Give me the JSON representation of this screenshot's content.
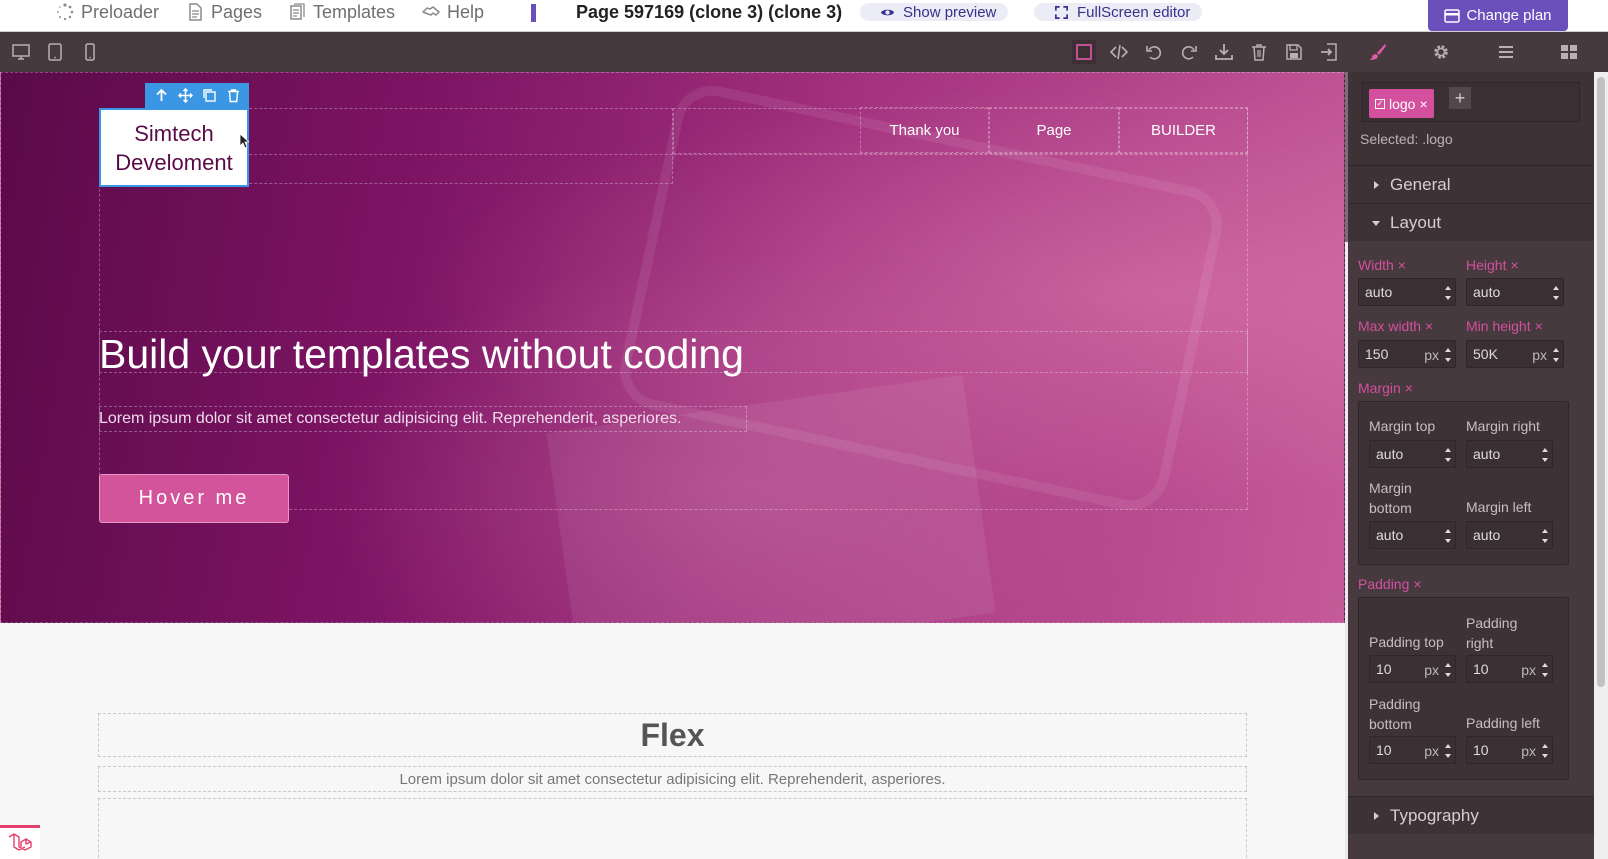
{
  "topnav": {
    "preloader": "Preloader",
    "pages": "Pages",
    "templates": "Templates",
    "help": "Help",
    "page_title": "Page 597169 (clone 3) (clone 3)",
    "show_preview": "Show preview",
    "fullscreen_editor": "FullScreen editor",
    "change_plan": "Change plan"
  },
  "canvas": {
    "logo_text": "Simtech Develoment",
    "nav_links": [
      "Thank you",
      "Page",
      "BUILDER"
    ],
    "hero_title": "Build your templates without coding",
    "hero_subtitle": "Lorem ipsum dolor sit amet consectetur adipisicing elit. Reprehenderit, asperiores.",
    "hero_button": "Hover me",
    "flex_title": "Flex",
    "flex_subtitle": "Lorem ipsum dolor sit amet consectetur adipisicing elit. Reprehenderit, asperiores."
  },
  "panel": {
    "tag": "logo",
    "tag_remove": "×",
    "tag_add": "+",
    "selected_label": "Selected: .logo",
    "sectors": {
      "general": "General",
      "layout": "Layout",
      "typography": "Typography"
    },
    "props": {
      "width": {
        "label": "Width",
        "value": "auto"
      },
      "height": {
        "label": "Height",
        "value": "auto"
      },
      "max_width": {
        "label": "Max width",
        "value": "150",
        "unit": "px"
      },
      "min_height": {
        "label": "Min height",
        "value": "50K",
        "unit": "px"
      },
      "margin": {
        "label": "Margin"
      },
      "margin_top": {
        "label": "Margin top",
        "value": "auto"
      },
      "margin_right": {
        "label": "Margin right",
        "value": "auto"
      },
      "margin_bottom": {
        "label": "Margin bottom",
        "value": "auto"
      },
      "margin_left": {
        "label": "Margin left",
        "value": "auto"
      },
      "padding": {
        "label": "Padding"
      },
      "padding_top": {
        "label": "Padding top",
        "value": "10",
        "unit": "px"
      },
      "padding_right": {
        "label": "Padding right",
        "value": "10",
        "unit": "px"
      },
      "padding_bottom": {
        "label": "Padding bottom",
        "value": "10",
        "unit": "px"
      },
      "padding_left": {
        "label": "Padding left",
        "value": "10",
        "unit": "px"
      }
    },
    "clear_symbol": "×"
  },
  "colors": {
    "accent": "#6b4fbb",
    "toolbar_bg": "#463a3e",
    "panel_highlight": "#d44f9e",
    "selection": "#3b97e3"
  },
  "icons": {
    "toolbar_left": [
      "desktop-icon",
      "tablet-icon",
      "mobile-icon"
    ],
    "toolbar_right": [
      "border-toggle-icon",
      "code-icon",
      "undo-icon",
      "redo-icon",
      "download-icon",
      "trash-icon",
      "save-icon",
      "import-icon",
      "style-manager-icon",
      "settings-icon",
      "layers-icon",
      "blocks-icon"
    ]
  }
}
